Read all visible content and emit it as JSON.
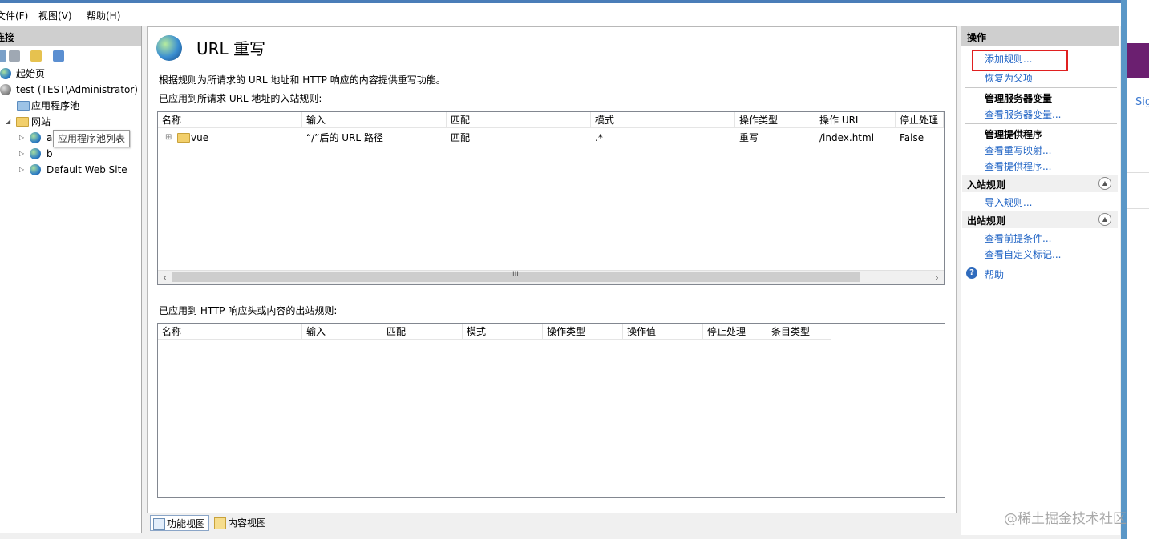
{
  "menu": [
    "文件(F)",
    "视图(V)",
    "帮助(H)"
  ],
  "connections": {
    "header": "连接",
    "tree": [
      {
        "label": "起始页"
      },
      {
        "label": "test (TEST\\Administrator)"
      },
      {
        "label": "应用程序池"
      },
      {
        "label": "网站"
      },
      {
        "label": "a"
      },
      {
        "label": "b"
      },
      {
        "label": "Default Web Site"
      }
    ],
    "tooltip": "应用程序池列表"
  },
  "main": {
    "title": "URL 重写",
    "description": "根据规则为所请求的 URL 地址和 HTTP 响应的内容提供重写功能。",
    "inbound_label": "已应用到所请求 URL 地址的入站规则:",
    "inbound_columns": [
      "名称",
      "输入",
      "匹配",
      "模式",
      "操作类型",
      "操作 URL",
      "停止处理"
    ],
    "inbound_rows": [
      {
        "name": "vue",
        "input": "“/”后的 URL 路径",
        "match": "匹配",
        "pattern": ".*",
        "action_type": "重写",
        "action_url": "/index.html",
        "stop": "False"
      }
    ],
    "outbound_label": "已应用到 HTTP 响应头或内容的出站规则:",
    "outbound_columns": [
      "名称",
      "输入",
      "匹配",
      "模式",
      "操作类型",
      "操作值",
      "停止处理",
      "条目类型"
    ]
  },
  "bottom_tabs": [
    "功能视图",
    "内容视图"
  ],
  "actions": {
    "header": "操作",
    "add_rule": "添加规则...",
    "revert_parent": "恢复为父项",
    "server_vars_title": "管理服务器变量",
    "view_server_vars": "查看服务器变量...",
    "providers_title": "管理提供程序",
    "view_rewrite_maps": "查看重写映射...",
    "view_providers": "查看提供程序...",
    "inbound_section": "入站规则",
    "import_rules": "导入规则...",
    "outbound_section": "出站规则",
    "view_preconditions": "查看前提条件...",
    "view_custom_tags": "查看自定义标记...",
    "help": "帮助"
  },
  "outside": {
    "text": "Sig"
  },
  "watermark": "@稀土掘金技术社区",
  "colors": {
    "link": "#1f63c4",
    "highlight_box": "#e02020",
    "panel_header": "#cfcfcf"
  }
}
